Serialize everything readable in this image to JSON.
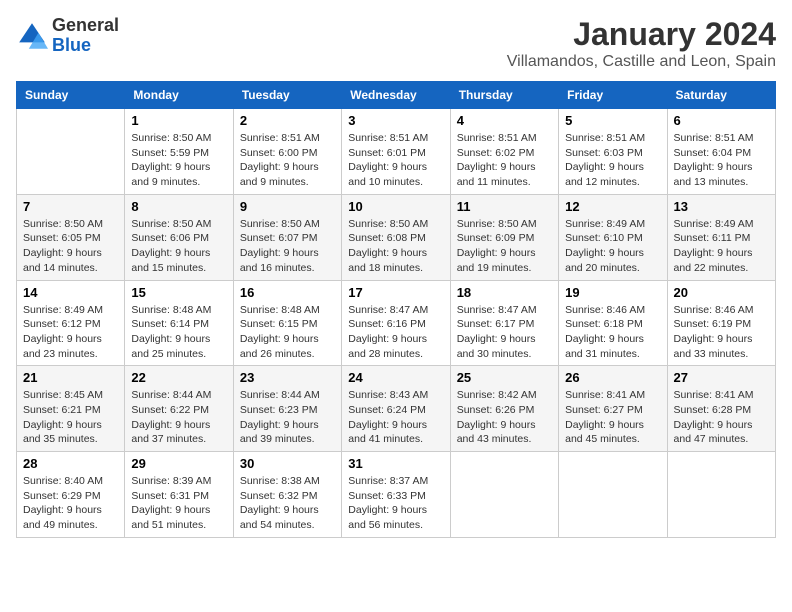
{
  "header": {
    "logo": {
      "general": "General",
      "blue": "Blue"
    },
    "title": "January 2024",
    "location": "Villamandos, Castille and Leon, Spain"
  },
  "days_of_week": [
    "Sunday",
    "Monday",
    "Tuesday",
    "Wednesday",
    "Thursday",
    "Friday",
    "Saturday"
  ],
  "weeks": [
    [
      {
        "day": "",
        "sunrise": "",
        "sunset": "",
        "daylight": ""
      },
      {
        "day": "1",
        "sunrise": "Sunrise: 8:50 AM",
        "sunset": "Sunset: 5:59 PM",
        "daylight": "Daylight: 9 hours and 9 minutes."
      },
      {
        "day": "2",
        "sunrise": "Sunrise: 8:51 AM",
        "sunset": "Sunset: 6:00 PM",
        "daylight": "Daylight: 9 hours and 9 minutes."
      },
      {
        "day": "3",
        "sunrise": "Sunrise: 8:51 AM",
        "sunset": "Sunset: 6:01 PM",
        "daylight": "Daylight: 9 hours and 10 minutes."
      },
      {
        "day": "4",
        "sunrise": "Sunrise: 8:51 AM",
        "sunset": "Sunset: 6:02 PM",
        "daylight": "Daylight: 9 hours and 11 minutes."
      },
      {
        "day": "5",
        "sunrise": "Sunrise: 8:51 AM",
        "sunset": "Sunset: 6:03 PM",
        "daylight": "Daylight: 9 hours and 12 minutes."
      },
      {
        "day": "6",
        "sunrise": "Sunrise: 8:51 AM",
        "sunset": "Sunset: 6:04 PM",
        "daylight": "Daylight: 9 hours and 13 minutes."
      }
    ],
    [
      {
        "day": "7",
        "sunrise": "Sunrise: 8:50 AM",
        "sunset": "Sunset: 6:05 PM",
        "daylight": "Daylight: 9 hours and 14 minutes."
      },
      {
        "day": "8",
        "sunrise": "Sunrise: 8:50 AM",
        "sunset": "Sunset: 6:06 PM",
        "daylight": "Daylight: 9 hours and 15 minutes."
      },
      {
        "day": "9",
        "sunrise": "Sunrise: 8:50 AM",
        "sunset": "Sunset: 6:07 PM",
        "daylight": "Daylight: 9 hours and 16 minutes."
      },
      {
        "day": "10",
        "sunrise": "Sunrise: 8:50 AM",
        "sunset": "Sunset: 6:08 PM",
        "daylight": "Daylight: 9 hours and 18 minutes."
      },
      {
        "day": "11",
        "sunrise": "Sunrise: 8:50 AM",
        "sunset": "Sunset: 6:09 PM",
        "daylight": "Daylight: 9 hours and 19 minutes."
      },
      {
        "day": "12",
        "sunrise": "Sunrise: 8:49 AM",
        "sunset": "Sunset: 6:10 PM",
        "daylight": "Daylight: 9 hours and 20 minutes."
      },
      {
        "day": "13",
        "sunrise": "Sunrise: 8:49 AM",
        "sunset": "Sunset: 6:11 PM",
        "daylight": "Daylight: 9 hours and 22 minutes."
      }
    ],
    [
      {
        "day": "14",
        "sunrise": "Sunrise: 8:49 AM",
        "sunset": "Sunset: 6:12 PM",
        "daylight": "Daylight: 9 hours and 23 minutes."
      },
      {
        "day": "15",
        "sunrise": "Sunrise: 8:48 AM",
        "sunset": "Sunset: 6:14 PM",
        "daylight": "Daylight: 9 hours and 25 minutes."
      },
      {
        "day": "16",
        "sunrise": "Sunrise: 8:48 AM",
        "sunset": "Sunset: 6:15 PM",
        "daylight": "Daylight: 9 hours and 26 minutes."
      },
      {
        "day": "17",
        "sunrise": "Sunrise: 8:47 AM",
        "sunset": "Sunset: 6:16 PM",
        "daylight": "Daylight: 9 hours and 28 minutes."
      },
      {
        "day": "18",
        "sunrise": "Sunrise: 8:47 AM",
        "sunset": "Sunset: 6:17 PM",
        "daylight": "Daylight: 9 hours and 30 minutes."
      },
      {
        "day": "19",
        "sunrise": "Sunrise: 8:46 AM",
        "sunset": "Sunset: 6:18 PM",
        "daylight": "Daylight: 9 hours and 31 minutes."
      },
      {
        "day": "20",
        "sunrise": "Sunrise: 8:46 AM",
        "sunset": "Sunset: 6:19 PM",
        "daylight": "Daylight: 9 hours and 33 minutes."
      }
    ],
    [
      {
        "day": "21",
        "sunrise": "Sunrise: 8:45 AM",
        "sunset": "Sunset: 6:21 PM",
        "daylight": "Daylight: 9 hours and 35 minutes."
      },
      {
        "day": "22",
        "sunrise": "Sunrise: 8:44 AM",
        "sunset": "Sunset: 6:22 PM",
        "daylight": "Daylight: 9 hours and 37 minutes."
      },
      {
        "day": "23",
        "sunrise": "Sunrise: 8:44 AM",
        "sunset": "Sunset: 6:23 PM",
        "daylight": "Daylight: 9 hours and 39 minutes."
      },
      {
        "day": "24",
        "sunrise": "Sunrise: 8:43 AM",
        "sunset": "Sunset: 6:24 PM",
        "daylight": "Daylight: 9 hours and 41 minutes."
      },
      {
        "day": "25",
        "sunrise": "Sunrise: 8:42 AM",
        "sunset": "Sunset: 6:26 PM",
        "daylight": "Daylight: 9 hours and 43 minutes."
      },
      {
        "day": "26",
        "sunrise": "Sunrise: 8:41 AM",
        "sunset": "Sunset: 6:27 PM",
        "daylight": "Daylight: 9 hours and 45 minutes."
      },
      {
        "day": "27",
        "sunrise": "Sunrise: 8:41 AM",
        "sunset": "Sunset: 6:28 PM",
        "daylight": "Daylight: 9 hours and 47 minutes."
      }
    ],
    [
      {
        "day": "28",
        "sunrise": "Sunrise: 8:40 AM",
        "sunset": "Sunset: 6:29 PM",
        "daylight": "Daylight: 9 hours and 49 minutes."
      },
      {
        "day": "29",
        "sunrise": "Sunrise: 8:39 AM",
        "sunset": "Sunset: 6:31 PM",
        "daylight": "Daylight: 9 hours and 51 minutes."
      },
      {
        "day": "30",
        "sunrise": "Sunrise: 8:38 AM",
        "sunset": "Sunset: 6:32 PM",
        "daylight": "Daylight: 9 hours and 54 minutes."
      },
      {
        "day": "31",
        "sunrise": "Sunrise: 8:37 AM",
        "sunset": "Sunset: 6:33 PM",
        "daylight": "Daylight: 9 hours and 56 minutes."
      },
      {
        "day": "",
        "sunrise": "",
        "sunset": "",
        "daylight": ""
      },
      {
        "day": "",
        "sunrise": "",
        "sunset": "",
        "daylight": ""
      },
      {
        "day": "",
        "sunrise": "",
        "sunset": "",
        "daylight": ""
      }
    ]
  ]
}
